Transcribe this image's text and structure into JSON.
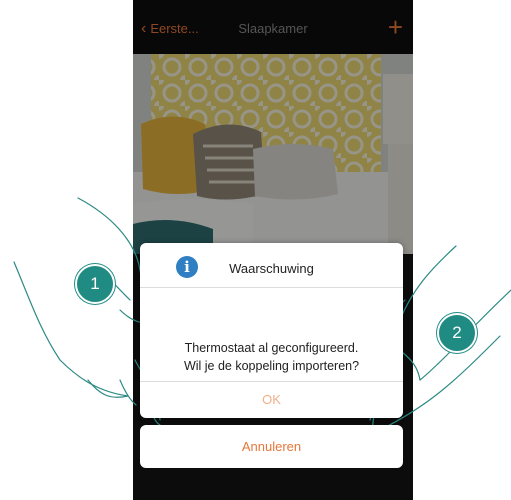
{
  "header": {
    "back_label": "Eerste...",
    "title": "Slaapkamer",
    "add_symbol": "+"
  },
  "dialog": {
    "icon_letter": "i",
    "title": "Waarschuwing",
    "message_line1": "Thermostaat al geconfigureerd.",
    "message_line2": "Wil je de koppeling importeren?",
    "ok_label": "OK"
  },
  "cancel_label": "Annuleren",
  "steps": [
    "1",
    "2"
  ],
  "colors": {
    "accent": "#e6763a",
    "info_icon": "#2f7fc2",
    "step_badge": "#1f8b83"
  }
}
